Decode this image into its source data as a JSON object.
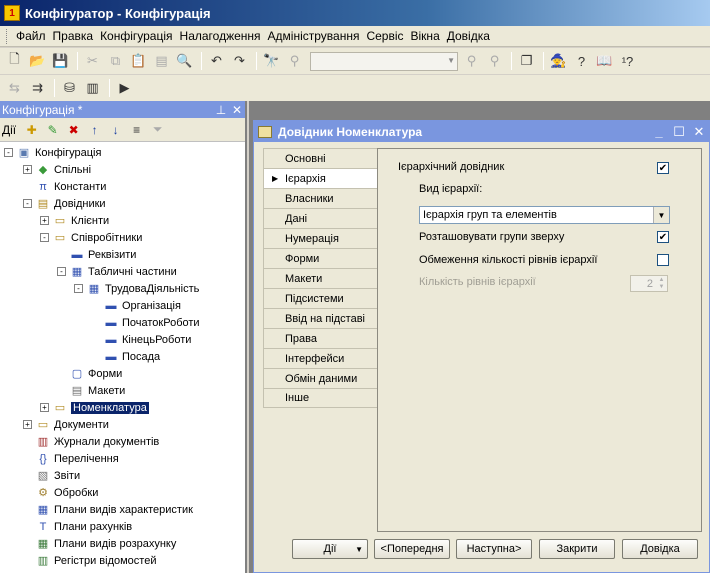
{
  "window": {
    "title": "Конфігуратор - Конфігурація"
  },
  "menu": [
    {
      "label": "Файл"
    },
    {
      "label": "Правка"
    },
    {
      "label": "Конфігурація"
    },
    {
      "label": "Налагодження"
    },
    {
      "label": "Адміністрування"
    },
    {
      "label": "Сервіс"
    },
    {
      "label": "Вікна"
    },
    {
      "label": "Довідка"
    }
  ],
  "left_panel": {
    "title": "Конфігурація *",
    "actions_label": "Дії",
    "tree": [
      {
        "label": "Конфігурація",
        "level": 0,
        "exp": "-",
        "icon": "config-icon"
      },
      {
        "label": "Спільні",
        "level": 1,
        "exp": "+",
        "icon": "common-icon"
      },
      {
        "label": "Константи",
        "level": 1,
        "exp": "",
        "icon": "constants-icon"
      },
      {
        "label": "Довідники",
        "level": 1,
        "exp": "-",
        "icon": "catalogs-icon"
      },
      {
        "label": "Клієнти",
        "level": 2,
        "exp": "+",
        "icon": "catalog-icon"
      },
      {
        "label": "Співробітники",
        "level": 2,
        "exp": "-",
        "icon": "catalog-icon"
      },
      {
        "label": "Реквізити",
        "level": 3,
        "exp": "",
        "icon": "attributes-icon"
      },
      {
        "label": "Табличні частини",
        "level": 3,
        "exp": "-",
        "icon": "table-icon"
      },
      {
        "label": "ТрудоваДіяльність",
        "level": 4,
        "exp": "-",
        "icon": "table-icon"
      },
      {
        "label": "Організація",
        "level": 5,
        "exp": "",
        "icon": "attribute-icon"
      },
      {
        "label": "ПочатокРоботи",
        "level": 5,
        "exp": "",
        "icon": "attribute-icon"
      },
      {
        "label": "КінецьРоботи",
        "level": 5,
        "exp": "",
        "icon": "attribute-icon"
      },
      {
        "label": "Посада",
        "level": 5,
        "exp": "",
        "icon": "attribute-icon"
      },
      {
        "label": "Форми",
        "level": 3,
        "exp": "",
        "icon": "forms-icon"
      },
      {
        "label": "Макети",
        "level": 3,
        "exp": "",
        "icon": "templates-icon"
      },
      {
        "label": "Номенклатура",
        "level": 2,
        "exp": "+",
        "icon": "catalog-icon",
        "selected": true
      },
      {
        "label": "Документи",
        "level": 1,
        "exp": "+",
        "icon": "documents-icon"
      },
      {
        "label": "Журнали документів",
        "level": 1,
        "exp": "",
        "icon": "journals-icon"
      },
      {
        "label": "Перелічення",
        "level": 1,
        "exp": "",
        "icon": "enums-icon"
      },
      {
        "label": "Звіти",
        "level": 1,
        "exp": "",
        "icon": "reports-icon"
      },
      {
        "label": "Обробки",
        "level": 1,
        "exp": "",
        "icon": "processing-icon"
      },
      {
        "label": "Плани видів характеристик",
        "level": 1,
        "exp": "",
        "icon": "chart-icon"
      },
      {
        "label": "Плани рахунків",
        "level": 1,
        "exp": "",
        "icon": "accounts-icon"
      },
      {
        "label": "Плани видів розрахунку",
        "level": 1,
        "exp": "",
        "icon": "calc-icon"
      },
      {
        "label": "Регістри відомостей",
        "level": 1,
        "exp": "",
        "icon": "registers-icon"
      }
    ]
  },
  "dialog": {
    "title": "Довідник Номенклатура",
    "tabs": [
      {
        "label": "Основні"
      },
      {
        "label": "Ієрархія",
        "active": true
      },
      {
        "label": "Власники"
      },
      {
        "label": "Дані"
      },
      {
        "label": "Нумерація"
      },
      {
        "label": "Форми"
      },
      {
        "label": "Макети"
      },
      {
        "label": "Підсистеми"
      },
      {
        "label": "Ввід на підставі"
      },
      {
        "label": "Права"
      },
      {
        "label": "Інтерфейси"
      },
      {
        "label": "Обмін даними"
      },
      {
        "label": "Інше"
      }
    ],
    "hierarchy": {
      "hierarchical_label": "Ієрархічний довідник",
      "hierarchical_checked": true,
      "type_label": "Вид ієрархії:",
      "type_value": "Ієрархія груп та елементів",
      "groups_top_label": "Розташовувати групи зверху",
      "groups_top_checked": true,
      "limit_levels_label": "Обмеження кількості рівнів ієрархії",
      "limit_levels_checked": false,
      "levels_count_label": "Кількість рівнів ієрархії",
      "levels_count_value": "2"
    },
    "buttons": {
      "actions": "Дії",
      "prev": "<Попередня",
      "next": "Наступна>",
      "close": "Закрити",
      "help": "Довідка"
    }
  }
}
